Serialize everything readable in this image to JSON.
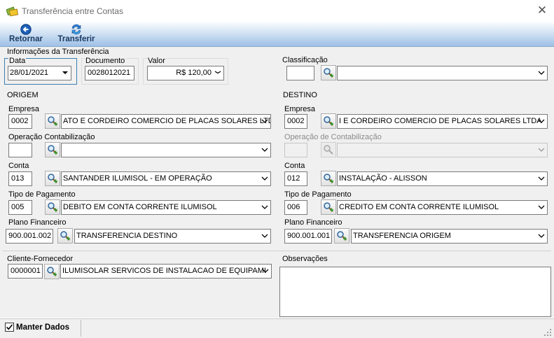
{
  "window": {
    "title": "Transferência entre Contas"
  },
  "toolbar": {
    "back_label": "Retornar",
    "transfer_label": "Transferir"
  },
  "info": {
    "legend": "Informações da Transferência",
    "data_label": "Data",
    "data_value": "28/01/2021",
    "documento_label": "Documento",
    "documento_value": "0028012021",
    "valor_label": "Valor",
    "valor_value": "R$ 120,00",
    "classificacao_label": "Classificação",
    "classificacao_code": "",
    "classificacao_value": ""
  },
  "origem": {
    "legend": "ORIGEM",
    "empresa_label": "Empresa",
    "empresa_code": "0002",
    "empresa_value": "ATO E CORDEIRO COMERCIO DE PLACAS SOLARES LTDA",
    "operacao_label": "Operação Contabilização",
    "operacao_code": "",
    "operacao_value": "",
    "conta_label": "Conta",
    "conta_code": "013",
    "conta_value": "SANTANDER ILUMISOL - EM OPERAÇÃO",
    "tipo_label": "Tipo de Pagamento",
    "tipo_code": "005",
    "tipo_value": "DEBITO EM CONTA CORRENTE ILUMISOL",
    "plano_label": "Plano Financeiro",
    "plano_code": "900.001.002",
    "plano_value": "TRANSFERENCIA DESTINO"
  },
  "destino": {
    "legend": "DESTINO",
    "empresa_label": "Empresa",
    "empresa_code": "0002",
    "empresa_value": "I E CORDEIRO COMERCIO DE PLACAS SOLARES LTDA",
    "operacao_label": "Operação de Contabilização",
    "operacao_code": "",
    "operacao_value": "",
    "conta_label": "Conta",
    "conta_code": "012",
    "conta_value": "INSTALAÇÃO - ALISSON",
    "tipo_label": "Tipo de Pagamento",
    "tipo_code": "006",
    "tipo_value": "CREDITO EM CONTA CORRENTE ILUMISOL",
    "plano_label": "Plano Financeiro",
    "plano_code": "900.001.001",
    "plano_value": "TRANSFERENCIA ORIGEM"
  },
  "cliente": {
    "label": "Cliente-Fornecedor",
    "code": "0000001",
    "value": "ILUMISOLAR SERVICOS DE INSTALACAO DE EQUIPAMI"
  },
  "observacoes": {
    "label": "Observações",
    "value": ""
  },
  "status": {
    "manter_label": "Manter Dados",
    "manter_checked": true
  },
  "colors": {
    "toolbar_top": "#fcfdff",
    "toolbar_bottom": "#9ec0e6",
    "panel_bg": "#f0f0f0",
    "toolbar_text": "#1b3a63"
  },
  "icons": {
    "app": "money-icon",
    "back": "back-arrow-icon",
    "transfer": "transfer-icon",
    "search": "search-add-icon",
    "dropdown": "chevron-down-icon"
  }
}
